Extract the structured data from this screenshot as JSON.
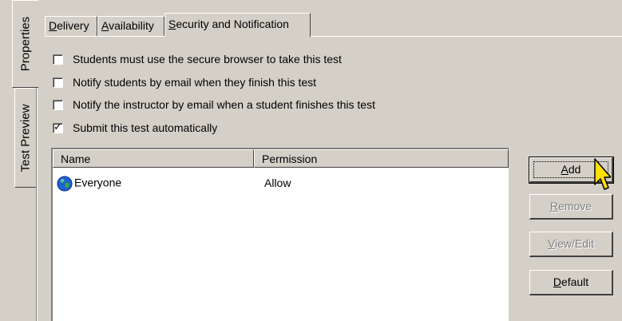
{
  "side_tabs": {
    "properties": "Properties",
    "test_preview": "Test Preview"
  },
  "tabs": {
    "delivery": {
      "pre": "",
      "key": "D",
      "post": "elivery"
    },
    "availability": {
      "pre": "",
      "key": "A",
      "post": "vailability"
    },
    "security": {
      "pre": "",
      "key": "S",
      "post": "ecurity and Notification"
    }
  },
  "options": [
    {
      "label": "Students must use the secure browser to take this test",
      "checked": false
    },
    {
      "label": "Notify students by email when they finish this test",
      "checked": false
    },
    {
      "label": "Notify the instructor by email when a student finishes this test",
      "checked": false
    },
    {
      "label": "Submit this test automatically",
      "checked": true
    }
  ],
  "permissions": {
    "columns": [
      "Name",
      "Permission"
    ],
    "rows": [
      {
        "name": "Everyone",
        "permission": "Allow",
        "icon": "globe-icon"
      }
    ]
  },
  "buttons": {
    "add": {
      "key": "A",
      "post": "dd"
    },
    "remove": {
      "key": "R",
      "post": "emove"
    },
    "view_edit": {
      "key": "V",
      "post": "iew/Edit"
    },
    "default": {
      "key": "D",
      "post": "efault"
    }
  },
  "colors": {
    "face": "#d4d0c8",
    "shadow": "#808080",
    "highlight": "#ffffff",
    "cursor": "#ffe000"
  }
}
